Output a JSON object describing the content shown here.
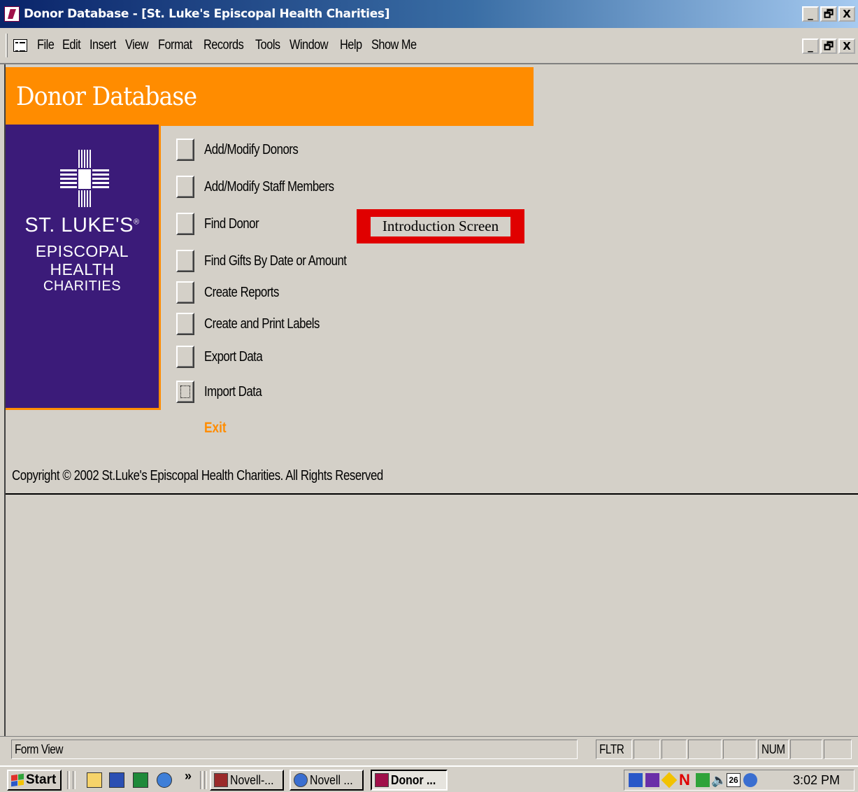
{
  "window": {
    "title": "Donor Database - [St. Luke's Episcopal Health Charities]",
    "controls": {
      "minimize": "_",
      "restore": "🗗",
      "close": "X"
    }
  },
  "menubar": {
    "items": [
      "File",
      "Edit",
      "Insert",
      "View",
      "Format",
      "Records",
      "Tools",
      "Window",
      "Help",
      "Show Me"
    ]
  },
  "form": {
    "header": "Donor Database",
    "logo": {
      "line1": "ST. LUKE'S",
      "registered": "®",
      "line2a": "EPISCOPAL",
      "line2b": "HEALTH",
      "line3": "CHARITIES"
    },
    "switchboard_items": [
      "Add/Modify Donors",
      "Add/Modify Staff Members",
      "Find Donor",
      "Find Gifts By Date or Amount",
      "Create Reports",
      "Create and Print Labels",
      "Export Data",
      "Import Data"
    ],
    "exit_label": "Exit",
    "copyright": "Copyright © 2002 St.Luke's Episcopal Health Charities. All Rights Reserved"
  },
  "annotation": {
    "label": "Introduction Screen",
    "border_color": "#e00000"
  },
  "statusbar": {
    "mode": "Form View",
    "indicators": [
      "FLTR",
      "",
      "",
      "",
      "",
      "NUM",
      "",
      ""
    ]
  },
  "taskbar": {
    "start_label": "Start",
    "chevron": "»",
    "tasks": [
      "Novell-...",
      "Novell ...",
      "Donor ..."
    ],
    "clock": "3:02 PM",
    "tray_calendar": "26"
  },
  "colors": {
    "orange": "#ff8c00",
    "purple": "#3b1b79",
    "win_gray": "#d4d0c8",
    "title_blue": "#0a246a"
  }
}
